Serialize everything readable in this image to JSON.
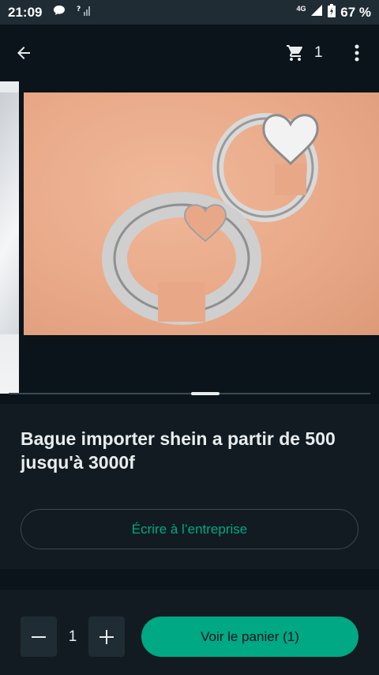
{
  "status_bar": {
    "time": "21:09",
    "network_label": "4G",
    "battery": "67 %",
    "icons": [
      "chat-bubble-icon",
      "signal-unknown-icon",
      "signal-icon",
      "battery-icon"
    ]
  },
  "app_bar": {
    "back_icon": "arrow-left-icon",
    "cart_icon": "cart-icon",
    "cart_count": "1",
    "menu_icon": "more-vertical-icon"
  },
  "product": {
    "image_description_icon": "product-image",
    "title": "Bague importer shein a partir de 500 jusqu'à 3000f",
    "contact_label": "Écrire à l’entreprise"
  },
  "quantity": {
    "value": "1",
    "minus_icon": "minus-icon",
    "plus_icon": "plus-icon"
  },
  "cta": {
    "label": "Voir le panier (1)"
  },
  "colors": {
    "accent": "#00a884",
    "background": "#0b141a",
    "surface": "#111b21",
    "status_bar": "#1f2c34"
  }
}
